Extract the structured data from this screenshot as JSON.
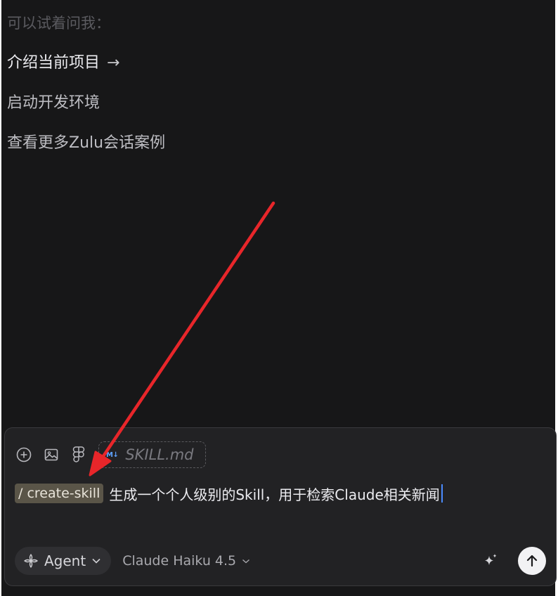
{
  "suggestions": {
    "header": "可以试着问我：",
    "items": [
      {
        "label": "介绍当前项目",
        "arrow": "→"
      },
      {
        "label": "启动开发环境"
      },
      {
        "label": "查看更多Zulu会话案例"
      }
    ]
  },
  "composer": {
    "attachment": {
      "icon": "M↓",
      "name": "SKILL.md"
    },
    "command_chip": "/ create-skill",
    "input_text": "生成一个个人级别的Skill，用于检索Claude相关新闻",
    "agent_label": "Agent",
    "model_label": "Claude Haiku 4.5"
  },
  "colors": {
    "background": "#171718",
    "composer": "#222224",
    "annotation_arrow": "#e8262a"
  },
  "icons": [
    "add-icon",
    "image-icon",
    "figma-icon",
    "markdown-icon",
    "agent-icon",
    "chevron-down-icon",
    "sparkle-icon",
    "arrow-up-icon"
  ]
}
